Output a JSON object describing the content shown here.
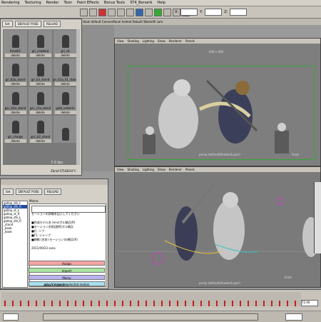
{
  "menubar": [
    "Rendering",
    "Texturing",
    "Render",
    "Toon",
    "Paint Effects",
    "Bonus Tools",
    "ST4_Berserk",
    "Help"
  ],
  "coords": {
    "x_label": "X:",
    "y_label": "Y:",
    "z_label": "Z:"
  },
  "status_text": "Hook  default  CameraPanel  helmet  Rebuilt  WasteAll  cam",
  "pose_library": {
    "buttons": [
      "Set",
      "DEFAULT POSE",
      "RELOAD"
    ],
    "poses": [
      {
        "name": "freak01",
        "action": "delete"
      },
      {
        "name": "gri_clubbed",
        "action": "delete"
      },
      {
        "name": "gri_cit",
        "action": "delete"
      },
      {
        "name": "gri_b2a_stand",
        "action": "delete"
      },
      {
        "name": "gri_b3_stand",
        "action": "delete"
      },
      {
        "name": "gri_b1a_01_stand",
        "action": "delete"
      },
      {
        "name": "gsc_b2a_stand",
        "action": "delete"
      },
      {
        "name": "gsc_c2a_stand",
        "action": "delete"
      },
      {
        "name": "gobl_unitorm",
        "action": "delete"
      },
      {
        "name": "gri_charge",
        "action": "delete"
      },
      {
        "name": "gsc_b2_stand",
        "action": "delete"
      },
      {
        "name": "",
        "action": ""
      }
    ],
    "fps": "7.0 fps",
    "footer": "Zbrief STUDIO4°C"
  },
  "viewport_top": {
    "menu": [
      "View",
      "Shading",
      "Lighting",
      "Show",
      "Renderer",
      "Panels"
    ],
    "resolution": "640 x 480",
    "camera": "persp (default/Shader/Layer)",
    "front": "Front"
  },
  "viewport_bottom": {
    "menu": [
      "View",
      "Shading",
      "Lighting",
      "Show",
      "Renderer",
      "Panels"
    ],
    "camera": "persp (default/Shader/Layer)",
    "front": "Front"
  },
  "motion_window": {
    "buttons": [
      "Set",
      "DEFAULT POSE",
      "RELOAD"
    ],
    "memo_label": "Memo:",
    "list": [
      {
        "label": "gallop_stk_L",
        "selected": false
      },
      {
        "label": "gallop_stk_R",
        "selected": true
      },
      {
        "label": "gallop_st_L",
        "selected": false
      },
      {
        "label": "gallop_st_R",
        "selected": false
      },
      {
        "label": "gallop_stk_L",
        "selected": false
      },
      {
        "label": "gallop_stk_R",
        "selected": false
      },
      {
        "label": "_stand",
        "selected": false
      },
      {
        "label": "_book",
        "selected": false
      },
      {
        "label": "_book",
        "selected": false
      }
    ],
    "memo_lines": [
      "モーションの詳細を記入してください",
      "",
      "■作成モデル名 (env)ガル騎兵(R)",
      "■モーション名前(説明)ガル騎兵",
      "■行 :ソフ",
      "■F1 :ジャンプ",
      "■移動 (名前 (モーション)の騎兵(R)",
      "",
      "2011/09/23  sano"
    ],
    "actions": [
      {
        "label": "Assign",
        "color": "#f5a3a3"
      },
      {
        "label": "Import",
        "color": "#a9e3a0"
      },
      {
        "label": "Memo",
        "color": "#b8b2f0"
      },
      {
        "label": "attach move to selected motion",
        "color": "#a9e0ef"
      }
    ],
    "footer": "zanix STUDIO4°C"
  },
  "timeline": {
    "current_frame": "72.00"
  },
  "colors": {
    "tick": "#c02020",
    "selection": "#224ca0",
    "panel": "#d4d0c8"
  }
}
